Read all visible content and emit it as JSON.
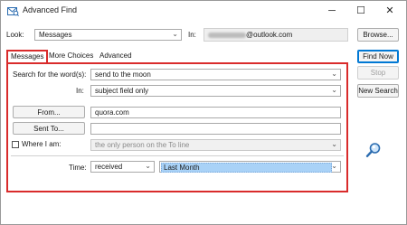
{
  "window": {
    "title": "Advanced Find",
    "controls": {
      "minimize": "─",
      "maximize": "☐",
      "close": "✕"
    }
  },
  "look": {
    "label": "Look:",
    "value": "Messages",
    "in_label": "In:",
    "in_value": "@outlook.com"
  },
  "buttons": {
    "browse": "Browse...",
    "find_now": "Find Now",
    "stop": "Stop",
    "new_search": "New Search"
  },
  "tabs": [
    {
      "label": "Messages",
      "active": true
    },
    {
      "label": "More Choices",
      "active": false
    },
    {
      "label": "Advanced",
      "active": false
    }
  ],
  "form": {
    "search_words_label": "Search for the word(s):",
    "search_words_value": "send to the moon",
    "in_label": "In:",
    "in_value": "subject field only",
    "from_button": "From...",
    "from_value": "quora.com",
    "sent_to_button": "Sent To...",
    "sent_to_value": "",
    "where_label": "Where I am:",
    "where_value": "the only person on the To line",
    "time_label": "Time:",
    "time_value": "received",
    "time_range_value": "Last Month"
  },
  "colors": {
    "highlight_border": "#d92b2b",
    "selection": "#a9d2f7",
    "default_button": "#0078d4"
  },
  "icons": {
    "search": "magnifier-icon",
    "title": "advanced-find-icon"
  }
}
